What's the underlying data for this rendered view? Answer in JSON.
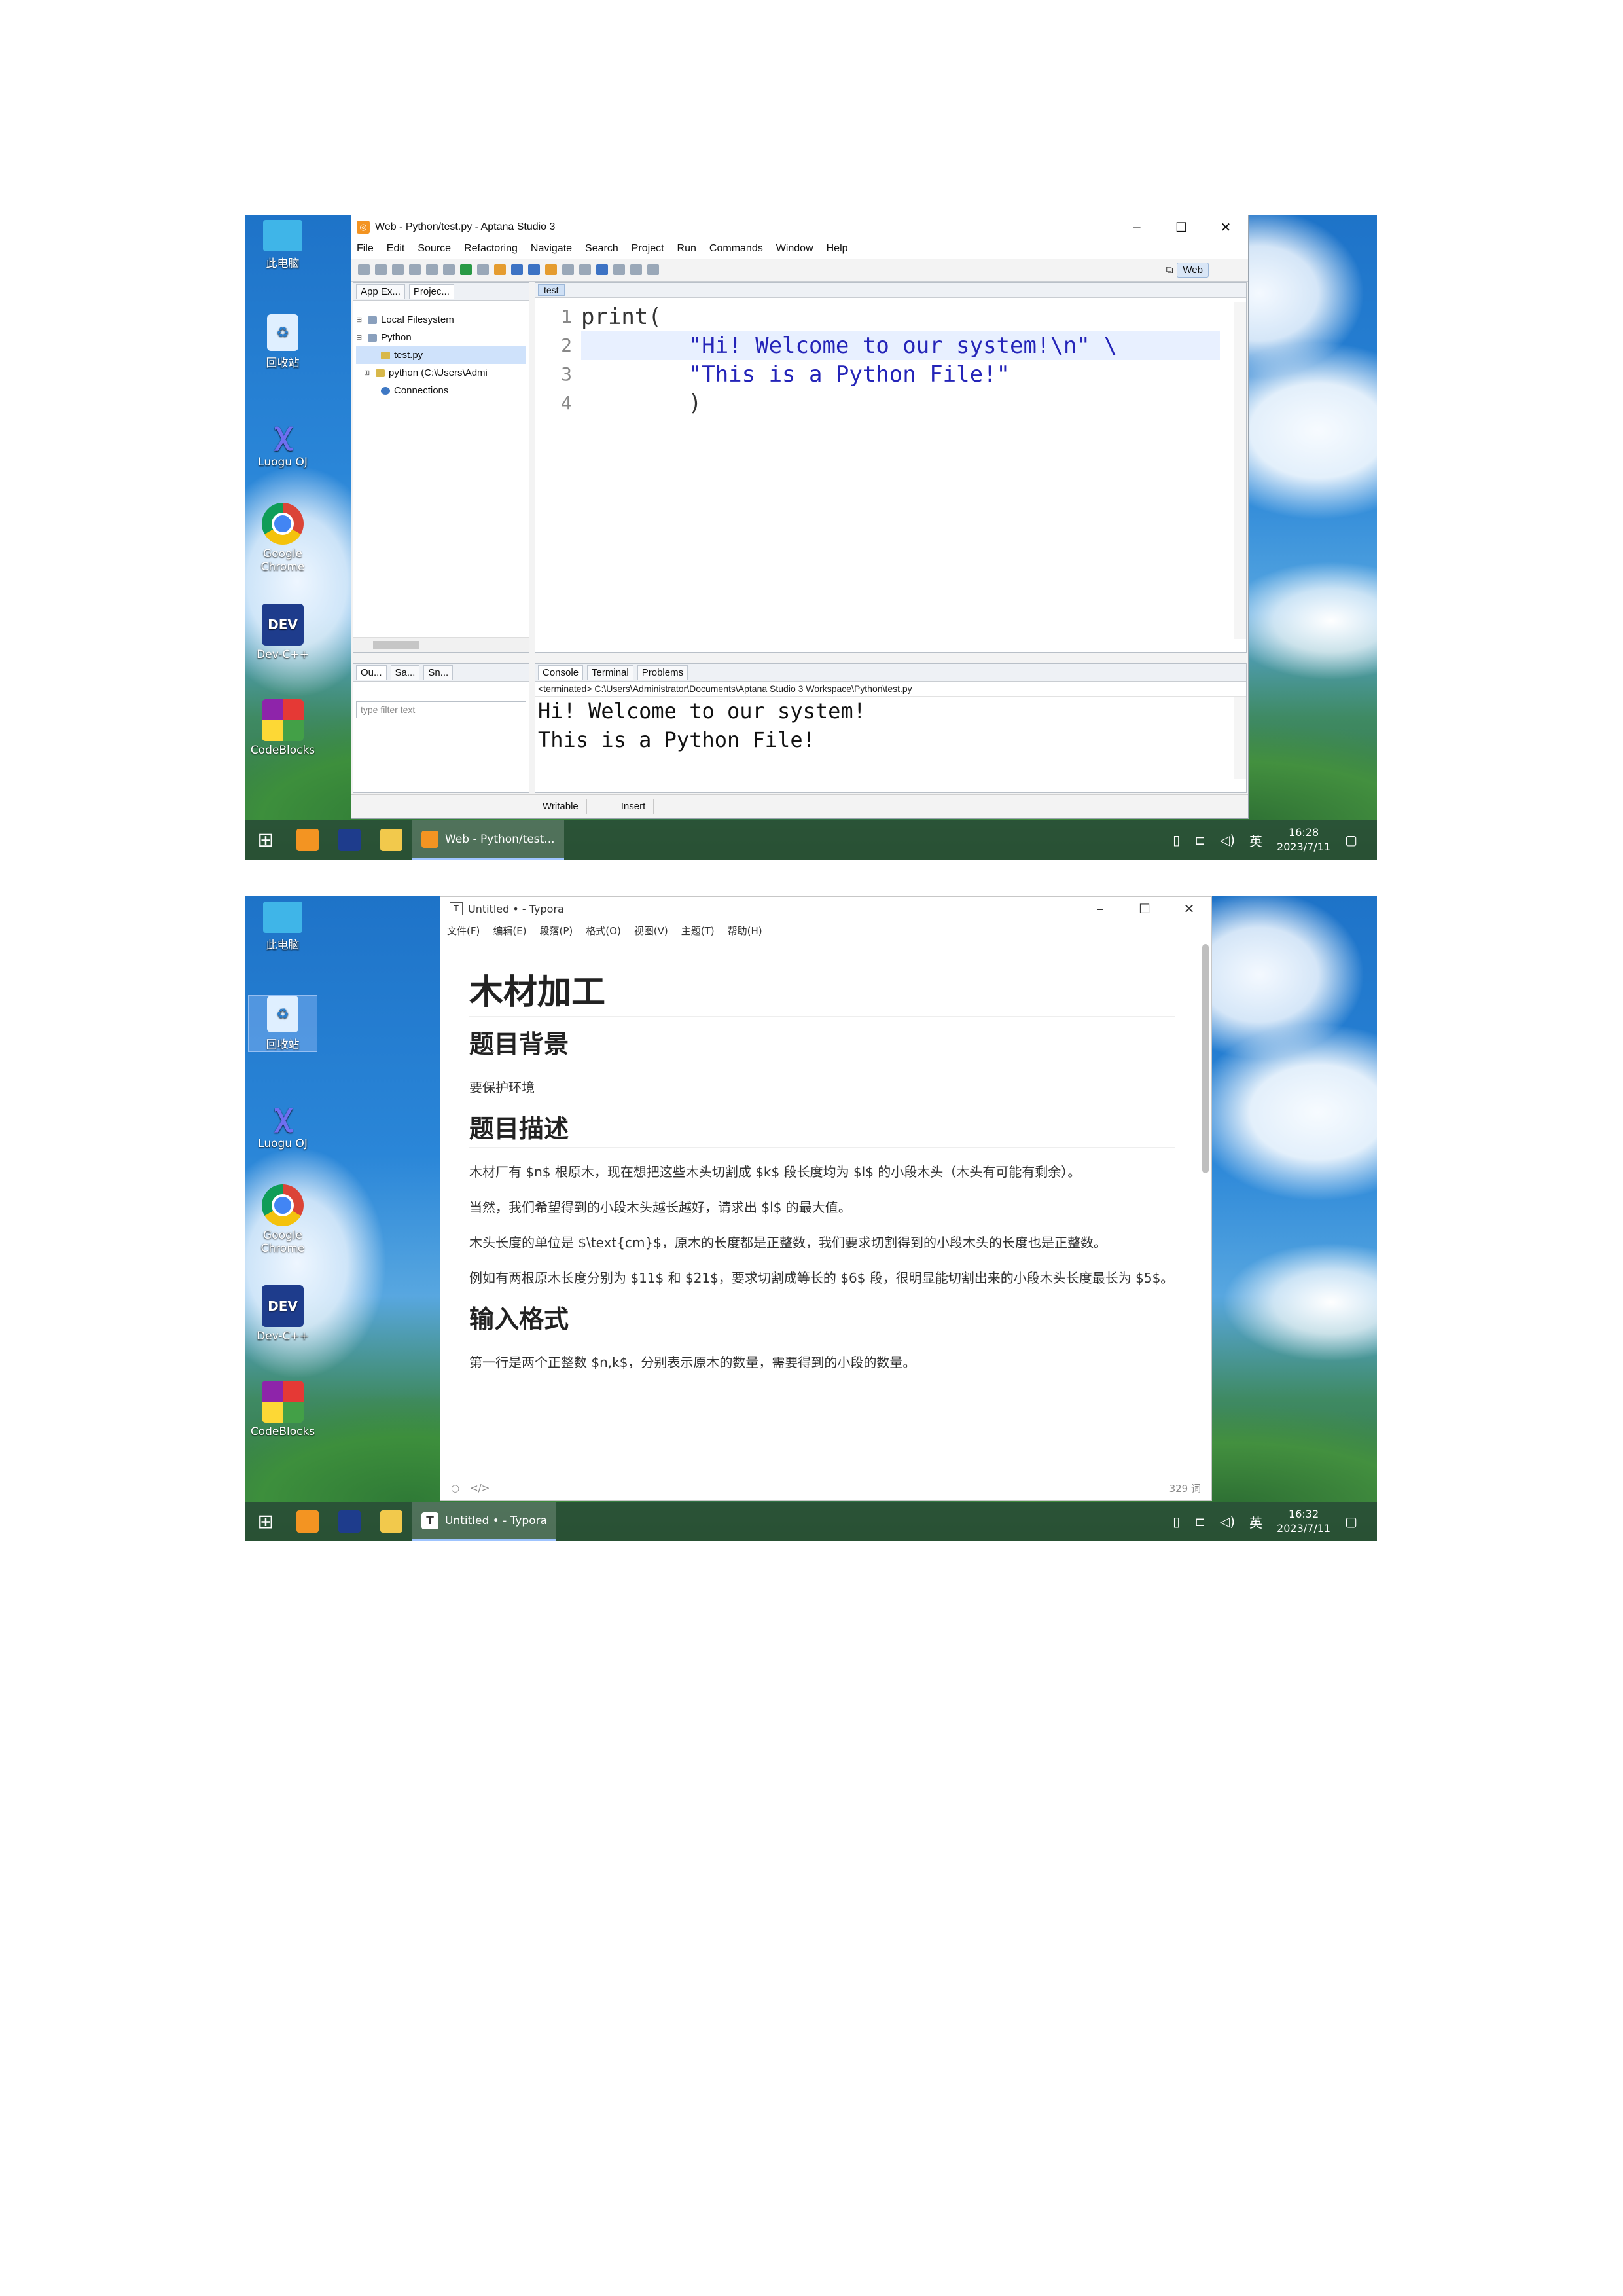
{
  "desktop_icons": [
    {
      "label": "此电脑",
      "icon": "computer-icon"
    },
    {
      "label": "回收站",
      "icon": "recycle-bin-icon"
    },
    {
      "label": "Luogu OJ",
      "icon": "luogu-icon"
    },
    {
      "label": "Google Chrome",
      "icon": "chrome-icon"
    },
    {
      "label": "Dev-C++",
      "icon": "dev-cpp-icon"
    },
    {
      "label": "CodeBlocks",
      "icon": "codeblocks-icon"
    }
  ],
  "screenshot1": {
    "window_title": "Web - Python/test.py - Aptana Studio 3",
    "menu": [
      "File",
      "Edit",
      "Source",
      "Refactoring",
      "Navigate",
      "Search",
      "Project",
      "Run",
      "Commands",
      "Window",
      "Help"
    ],
    "perspective": "Web",
    "left_tabs": [
      "App Ex...",
      "Projec..."
    ],
    "tree": [
      {
        "label": "Local Filesystem",
        "exp": "⊞"
      },
      {
        "label": "Python",
        "exp": "⊟"
      },
      {
        "label": "test.py",
        "exp": ""
      },
      {
        "label": "python  (C:\\Users\\Admi",
        "exp": "⊞"
      },
      {
        "label": "Connections",
        "exp": ""
      }
    ],
    "outline_tabs": [
      "Ou...",
      "Sa...",
      "Sn..."
    ],
    "filter_placeholder": "type filter text",
    "editor_tab": "test",
    "code_lines": [
      {
        "num": "1",
        "text": "print("
      },
      {
        "num": "2",
        "text": "        \"Hi! Welcome to our system!\\n\" \\"
      },
      {
        "num": "3",
        "text": "        \"This is a Python File!\""
      },
      {
        "num": "4",
        "text": "        )"
      }
    ],
    "console_tabs": [
      "Console",
      "Terminal",
      "Problems"
    ],
    "console_path": "<terminated> C:\\Users\\Administrator\\Documents\\Aptana Studio 3 Workspace\\Python\\test.py",
    "console_output": [
      "Hi! Welcome to our system!",
      "This is a Python File!"
    ],
    "status": [
      "Writable",
      "Insert"
    ],
    "taskbar_app": "Web - Python/test...",
    "clock_time": "16:28",
    "clock_date": "2023/7/11",
    "ime": "英"
  },
  "screenshot2": {
    "window_title": "Untitled • - Typora",
    "menu": [
      "文件(F)",
      "编辑(E)",
      "段落(P)",
      "格式(O)",
      "视图(V)",
      "主题(T)",
      "帮助(H)"
    ],
    "h1": "木材加工",
    "sections": [
      {
        "h2": "题目背景",
        "paras": [
          "要保护环境"
        ]
      },
      {
        "h2": "题目描述",
        "paras": [
          "木材厂有 $n$ 根原木，现在想把这些木头切割成 $k$ 段长度均为 $l$ 的小段木头（木头有可能有剩余）。",
          "当然，我们希望得到的小段木头越长越好，请求出 $l$ 的最大值。",
          "木头长度的单位是 $\\text{cm}$，原木的长度都是正整数，我们要求切割得到的小段木头的长度也是正整数。",
          "例如有两根原木长度分别为 $11$ 和 $21$，要求切割成等长的 $6$ 段，很明显能切割出来的小段木头长度最长为 $5$。"
        ]
      },
      {
        "h2": "输入格式",
        "paras": [
          "第一行是两个正整数 $n,k$，分别表示原木的数量，需要得到的小段的数量。"
        ]
      }
    ],
    "word_count": "329 词",
    "taskbar_app": "Untitled • - Typora",
    "clock_time": "16:32",
    "clock_date": "2023/7/11",
    "ime": "英"
  }
}
